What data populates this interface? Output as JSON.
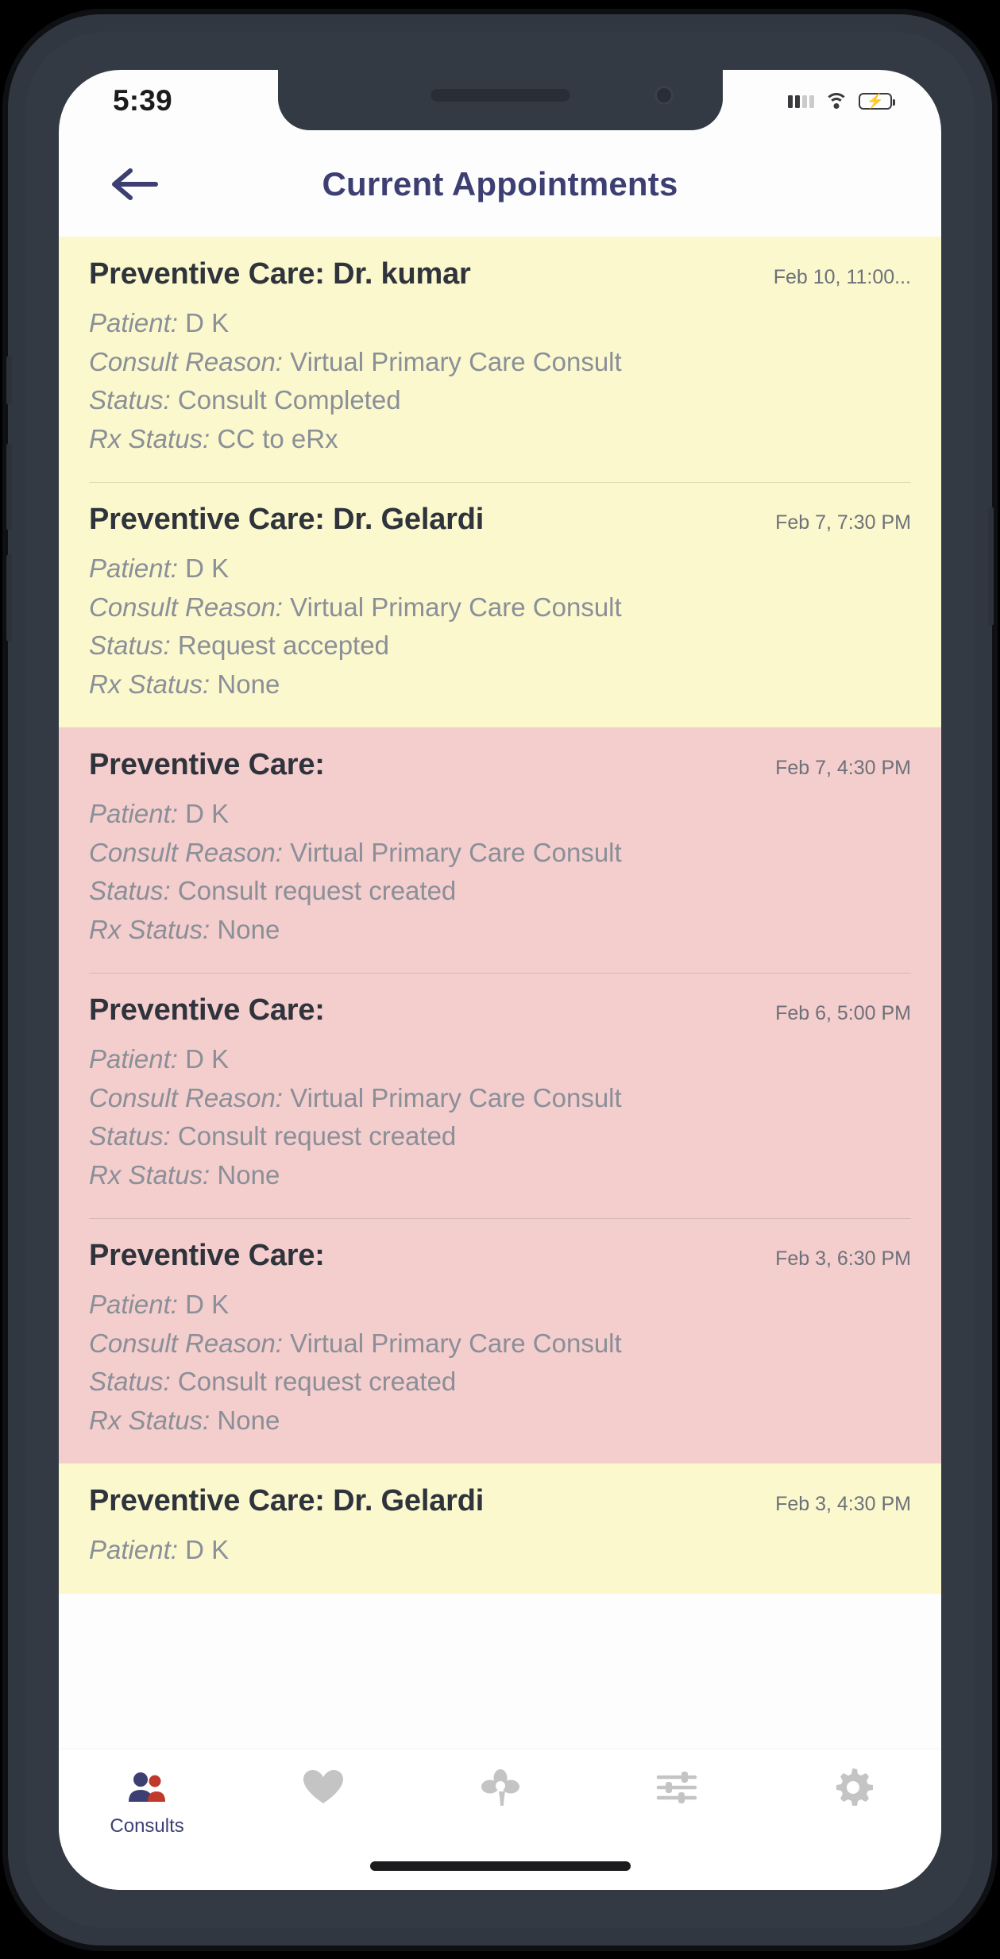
{
  "status_bar": {
    "time": "5:39",
    "signal_icon": "cellular-signal-icon",
    "wifi_icon": "wifi-icon",
    "battery_icon": "battery-charging-icon",
    "battery_color": "#35c759"
  },
  "header": {
    "back_icon": "back-arrow-icon",
    "title": "Current Appointments",
    "title_color": "#3d3f72"
  },
  "labels": {
    "patient": "Patient:",
    "consult_reason": "Consult Reason:",
    "status": "Status:",
    "rx_status": "Rx Status:"
  },
  "tones": {
    "yellow": "#fbf8cd",
    "pink": "#f4cdcd"
  },
  "appointments": [
    {
      "title": "Preventive Care: Dr. kumar",
      "date": "Feb 10, 11:00...",
      "patient": "D K",
      "consult_reason": "Virtual Primary Care Consult",
      "status": "Consult Completed",
      "rx_status": "CC to eRx",
      "tone": "yellow",
      "divider": false
    },
    {
      "title": "Preventive Care: Dr. Gelardi",
      "date": "Feb 7, 7:30 PM",
      "patient": "D K",
      "consult_reason": "Virtual Primary Care Consult",
      "status": "Request accepted",
      "rx_status": "None",
      "tone": "yellow",
      "divider": true
    },
    {
      "title": "Preventive Care:",
      "date": "Feb 7, 4:30 PM",
      "patient": "D K",
      "consult_reason": "Virtual Primary Care Consult",
      "status": "Consult request created",
      "rx_status": "None",
      "tone": "pink",
      "divider": false
    },
    {
      "title": "Preventive Care:",
      "date": "Feb 6, 5:00 PM",
      "patient": "D K",
      "consult_reason": "Virtual Primary Care Consult",
      "status": "Consult request created",
      "rx_status": "None",
      "tone": "pink",
      "divider": true
    },
    {
      "title": "Preventive Care:",
      "date": "Feb 3, 6:30 PM",
      "patient": "D K",
      "consult_reason": "Virtual Primary Care Consult",
      "status": "Consult request created",
      "rx_status": "None",
      "tone": "pink",
      "divider": true
    },
    {
      "title": "Preventive Care: Dr. Gelardi",
      "date": "Feb 3, 4:30 PM",
      "patient": "D K",
      "consult_reason": "",
      "status": "",
      "rx_status": "",
      "tone": "yellow",
      "divider": false
    }
  ],
  "tab_bar": {
    "items": [
      {
        "icon": "people-group-icon",
        "label": "Consults",
        "active": true
      },
      {
        "icon": "heart-icon",
        "label": "",
        "active": false
      },
      {
        "icon": "flower-icon",
        "label": "",
        "active": false
      },
      {
        "icon": "sliders-icon",
        "label": "",
        "active": false
      },
      {
        "icon": "gear-icon",
        "label": "",
        "active": false
      }
    ],
    "active_color": "#3d3f72",
    "inactive_color": "#c4c4c4"
  }
}
